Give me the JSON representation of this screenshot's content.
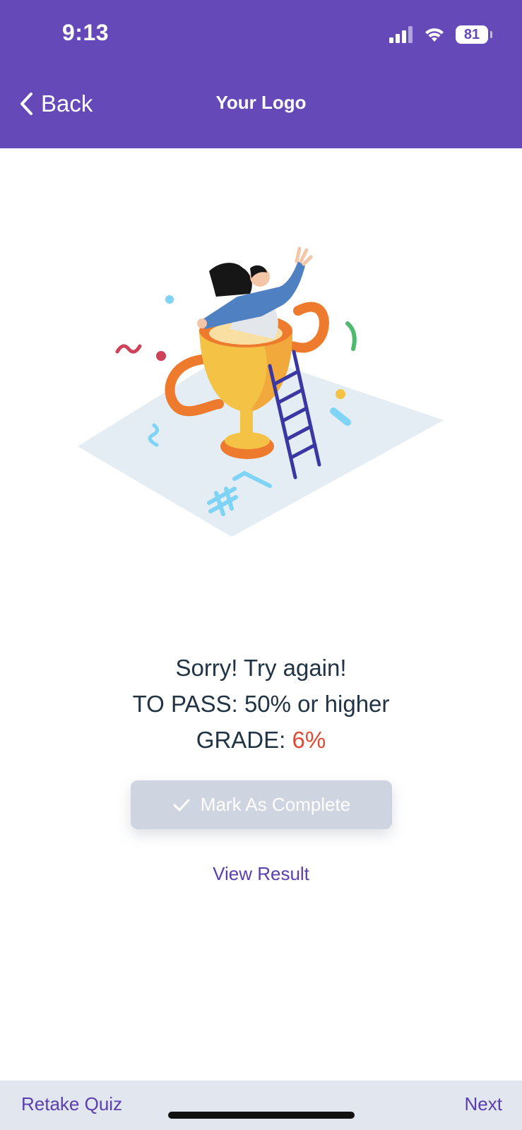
{
  "status": {
    "time": "9:13",
    "battery": "81"
  },
  "nav": {
    "back_label": "Back",
    "title": "Your Logo"
  },
  "result": {
    "message": "Sorry! Try again!",
    "pass_label": "TO PASS:",
    "pass_value": "50% or higher",
    "grade_label": "GRADE:",
    "grade_value": "6%"
  },
  "actions": {
    "mark_complete": "Mark As Complete",
    "view_result": "View Result"
  },
  "footer": {
    "retake": "Retake Quiz",
    "next": "Next"
  },
  "colors": {
    "header": "#6649b8",
    "accent": "#5a3fb0",
    "fail": "#e04a35",
    "disabled_button": "#cfd5e0"
  },
  "icons": [
    "signal-icon",
    "wifi-icon",
    "battery-icon",
    "chevron-left-icon",
    "checkmark-icon",
    "trophy-illustration"
  ]
}
